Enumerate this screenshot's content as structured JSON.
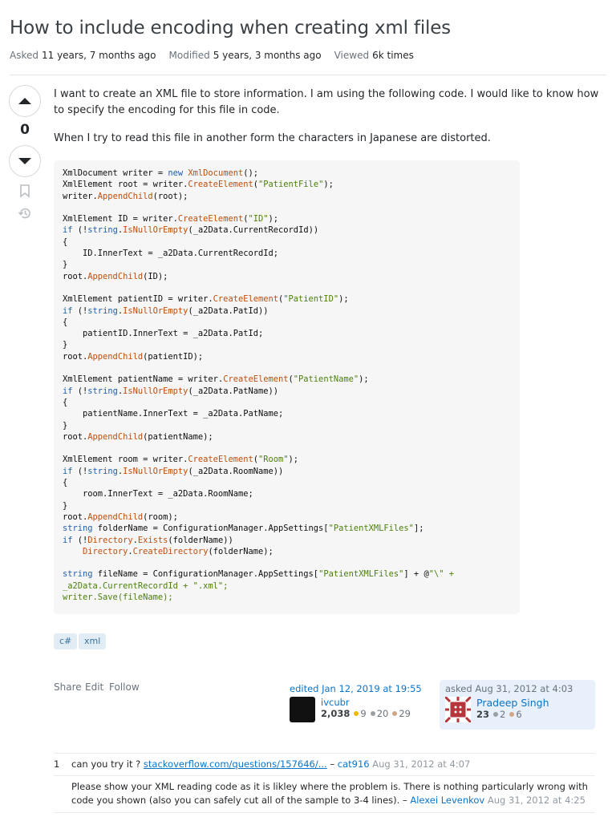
{
  "question": {
    "title": "How to include encoding when creating xml files",
    "meta": [
      {
        "label": "Asked",
        "value": "11 years, 7 months ago"
      },
      {
        "label": "Modified",
        "value": "5 years, 3 months ago"
      },
      {
        "label": "Viewed",
        "value": "6k times"
      }
    ],
    "score": "0",
    "paragraphs": [
      "I want to create an XML file to store information. I am using the following code. I would like to know how to specify the encoding for this file in code.",
      "When I try to read this file in another form the characters in Japanese are distorted."
    ],
    "code": [
      [
        [
          "",
          "XmlDocument writer = "
        ],
        [
          "kw",
          "new "
        ],
        [
          "fn",
          "XmlDocument"
        ],
        [
          "",
          "();"
        ]
      ],
      [
        [
          "",
          "XmlElement root = writer."
        ],
        [
          "fn",
          "CreateElement"
        ],
        [
          "",
          "("
        ],
        [
          "st",
          "\"PatientFile\""
        ],
        [
          "",
          ");"
        ]
      ],
      [
        [
          "",
          "writer."
        ],
        [
          "fn",
          "AppendChild"
        ],
        [
          "",
          "(root);"
        ]
      ],
      [],
      [
        [
          "",
          "XmlElement ID = writer."
        ],
        [
          "fn",
          "CreateElement"
        ],
        [
          "",
          "("
        ],
        [
          "st",
          "\"ID\""
        ],
        [
          "",
          ");"
        ]
      ],
      [
        [
          "kw",
          "if"
        ],
        [
          "",
          " (!"
        ],
        [
          "kw",
          "string"
        ],
        [
          "",
          "."
        ],
        [
          "fn",
          "IsNullOrEmpty"
        ],
        [
          "",
          "(_a2Data.CurrentRecordId))"
        ]
      ],
      [
        [
          "",
          "{"
        ]
      ],
      [
        [
          "",
          "    ID.InnerText = _a2Data.CurrentRecordId;"
        ]
      ],
      [
        [
          "",
          "}"
        ]
      ],
      [
        [
          "",
          "root."
        ],
        [
          "fn",
          "AppendChild"
        ],
        [
          "",
          "(ID);"
        ]
      ],
      [],
      [
        [
          "",
          "XmlElement patientID = writer."
        ],
        [
          "fn",
          "CreateElement"
        ],
        [
          "",
          "("
        ],
        [
          "st",
          "\"PatientID\""
        ],
        [
          "",
          ");"
        ]
      ],
      [
        [
          "kw",
          "if"
        ],
        [
          "",
          " (!"
        ],
        [
          "kw",
          "string"
        ],
        [
          "",
          "."
        ],
        [
          "fn",
          "IsNullOrEmpty"
        ],
        [
          "",
          "(_a2Data.PatId))"
        ]
      ],
      [
        [
          "",
          "{"
        ]
      ],
      [
        [
          "",
          "    patientID.InnerText = _a2Data.PatId;"
        ]
      ],
      [
        [
          "",
          "}"
        ]
      ],
      [
        [
          "",
          "root."
        ],
        [
          "fn",
          "AppendChild"
        ],
        [
          "",
          "(patientID);"
        ]
      ],
      [],
      [
        [
          "",
          "XmlElement patientName = writer."
        ],
        [
          "fn",
          "CreateElement"
        ],
        [
          "",
          "("
        ],
        [
          "st",
          "\"PatientName\""
        ],
        [
          "",
          ");"
        ]
      ],
      [
        [
          "kw",
          "if"
        ],
        [
          "",
          " (!"
        ],
        [
          "kw",
          "string"
        ],
        [
          "",
          "."
        ],
        [
          "fn",
          "IsNullOrEmpty"
        ],
        [
          "",
          "(_a2Data.PatName))"
        ]
      ],
      [
        [
          "",
          "{"
        ]
      ],
      [
        [
          "",
          "    patientName.InnerText = _a2Data.PatName;"
        ]
      ],
      [
        [
          "",
          "}"
        ]
      ],
      [
        [
          "",
          "root."
        ],
        [
          "fn",
          "AppendChild"
        ],
        [
          "",
          "(patientName);"
        ]
      ],
      [],
      [
        [
          "",
          "XmlElement room = writer."
        ],
        [
          "fn",
          "CreateElement"
        ],
        [
          "",
          "("
        ],
        [
          "st",
          "\"Room\""
        ],
        [
          "",
          ");"
        ]
      ],
      [
        [
          "kw",
          "if"
        ],
        [
          "",
          " (!"
        ],
        [
          "kw",
          "string"
        ],
        [
          "",
          "."
        ],
        [
          "fn",
          "IsNullOrEmpty"
        ],
        [
          "",
          "(_a2Data.RoomName))"
        ]
      ],
      [
        [
          "",
          "{"
        ]
      ],
      [
        [
          "",
          "    room.InnerText = _a2Data.RoomName;"
        ]
      ],
      [
        [
          "",
          "}"
        ]
      ],
      [
        [
          "",
          "root."
        ],
        [
          "fn",
          "AppendChild"
        ],
        [
          "",
          "(room);"
        ]
      ],
      [
        [
          "kw",
          "string"
        ],
        [
          "",
          " folderName = ConfigurationManager.AppSettings["
        ],
        [
          "st",
          "\"PatientXMLFiles\""
        ],
        [
          "",
          "];"
        ]
      ],
      [
        [
          "kw",
          "if"
        ],
        [
          "",
          " (!"
        ],
        [
          "fn",
          "Directory"
        ],
        [
          "",
          "."
        ],
        [
          "fn",
          "Exists"
        ],
        [
          "",
          "(folderName))"
        ]
      ],
      [
        [
          "",
          "    "
        ],
        [
          "fn",
          "Directory"
        ],
        [
          "",
          "."
        ],
        [
          "fn",
          "CreateDirectory"
        ],
        [
          "",
          "(folderName);"
        ]
      ],
      [],
      [
        [
          "kw",
          "string"
        ],
        [
          "",
          " fileName = ConfigurationManager.AppSettings["
        ],
        [
          "st",
          "\"PatientXMLFiles\""
        ],
        [
          "",
          "] + @"
        ],
        [
          "st",
          "\"\\\" +"
        ]
      ],
      [
        [
          "st",
          "_a2Data.CurrentRecordId + \".xml\";"
        ]
      ],
      [
        [
          "st",
          "writer.Save(fileName);"
        ]
      ]
    ],
    "tags": [
      "c#",
      "xml"
    ],
    "actions": [
      "Share",
      "Edit",
      "Follow"
    ],
    "editor": {
      "label": "edited Jan 12, 2019 at 19:55",
      "name": "ivcubr",
      "rep": "2,038",
      "gold": "9",
      "silver": "20",
      "bronze": "29"
    },
    "owner": {
      "label": "asked Aug 31, 2012 at 4:03",
      "name": "Pradeep Singh",
      "rep": "23",
      "silver": "2",
      "bronze": "6"
    },
    "comments": [
      {
        "score": "1",
        "text": "can you try it ? ",
        "link": "stackoverflow.com/questions/157646/...",
        "sep": " – ",
        "user": "cat916",
        "date": " Aug 31, 2012 at 4:07"
      },
      {
        "score": "",
        "text": "Please show your XML reading code as it is likley where the problem is. There is nothing particularly wrong with code you shown (also you can safely cut all of the sample to 3-4 lines).",
        "sep": " – ",
        "user": "Alexei Levenkov",
        "date": " Aug 31, 2012 at 4:25"
      }
    ]
  },
  "colors": {
    "gold": "#f1b600",
    "silver": "#9a9fa4",
    "bronze": "#d1a684",
    "link": "#0a74c9"
  }
}
